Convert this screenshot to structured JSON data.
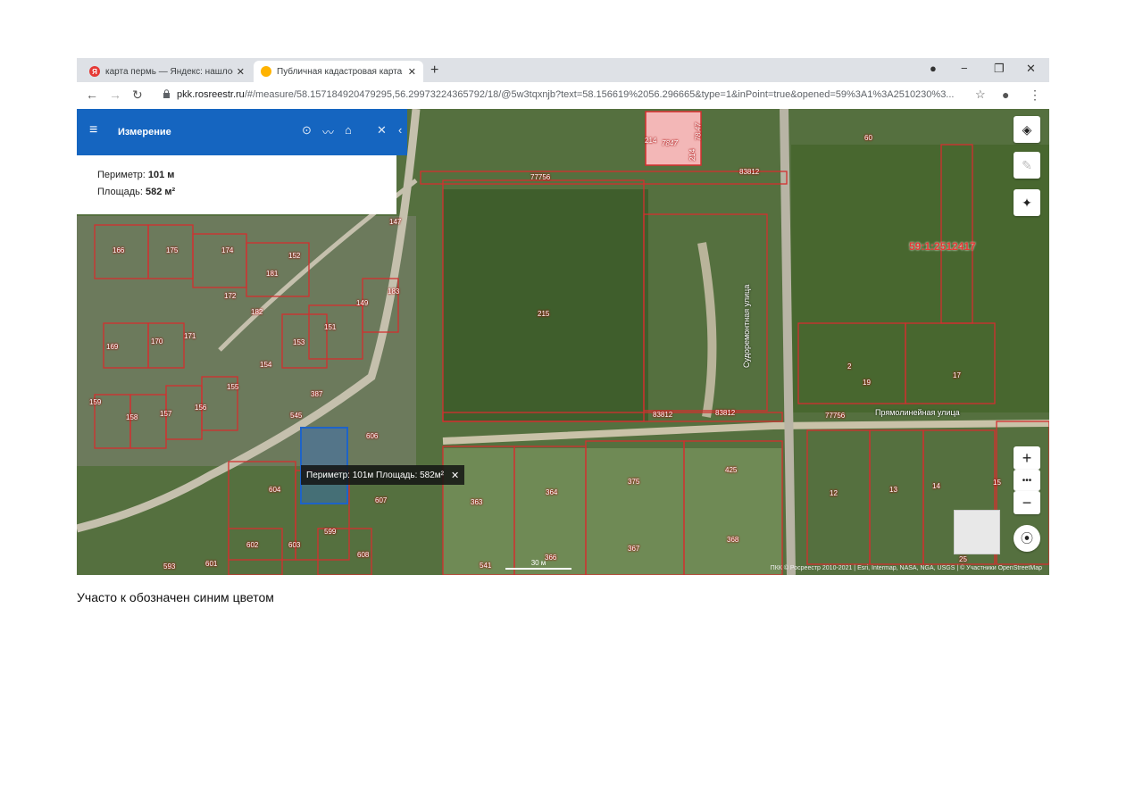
{
  "browser": {
    "tabs": [
      {
        "title": "карта пермь — Яндекс: нашлос",
        "close": "✕",
        "icon": "yandex-icon",
        "active": false
      },
      {
        "title": "Публичная кадастровая карта",
        "close": "✕",
        "icon": "rosreestr-icon",
        "active": true
      }
    ],
    "new_tab": "+",
    "address": {
      "host": "pkk.rosreestr.ru",
      "path": "/#/measure/58.157184920479295,56.29973224365792/18/@5w3tqxnjb?text=58.156619%2056.296665&type=1&inPoint=true&opened=59%3A1%3A2510230%3..."
    }
  },
  "panel": {
    "title": "Измерение",
    "perimeter_label": "Периметр:",
    "perimeter_value": "101 м",
    "area_label": "Площадь:",
    "area_value": "582 м²"
  },
  "tooltip": {
    "text": "Периметр: 101м Площадь: 582м²",
    "close": "✕"
  },
  "map": {
    "parcel_labels": [
      "60",
      "147",
      "166",
      "175",
      "174",
      "152",
      "181",
      "183",
      "172",
      "182",
      "149",
      "151",
      "153",
      "170",
      "171",
      "169",
      "154",
      "155",
      "387",
      "159",
      "158",
      "157",
      "156",
      "545",
      "606",
      "604",
      "607",
      "599",
      "602",
      "603",
      "608",
      "593",
      "601",
      "215",
      "363",
      "364",
      "375",
      "425",
      "367",
      "368",
      "366",
      "541",
      "12",
      "13",
      "14",
      "15",
      "17",
      "19",
      "2",
      "25",
      "214",
      "7847",
      "214",
      "78.47"
    ],
    "road_labels": [
      "77756",
      "83812",
      "83812",
      "83812",
      "77756"
    ],
    "cadastral_block": "59:1:2512417",
    "streets": [
      "Судоремонтная улица",
      "Прямолинейная улица"
    ],
    "scale": "30 м",
    "attribution": "ПКК © Росреестр 2010-2021 | Esri, Intermap, NASA, NGA, USGS | © Участники OpenStreetMap",
    "zoom_in": "+",
    "zoom_more": "•••",
    "zoom_out": "−"
  },
  "caption": "Участо к обозначен синим цветом",
  "colors": {
    "panel_blue": "#1565c0",
    "parcel_line": "#d32f2f",
    "selected_parcel": "#1e63c8"
  }
}
